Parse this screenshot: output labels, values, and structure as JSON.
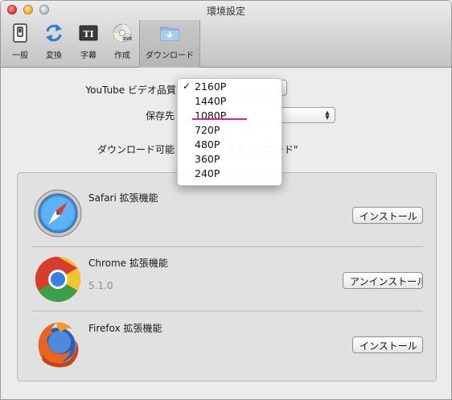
{
  "window": {
    "title": "環境設定"
  },
  "toolbar": {
    "items": [
      {
        "label": "一般",
        "icon": "switch-icon"
      },
      {
        "label": "変換",
        "icon": "convert-arrows-icon"
      },
      {
        "label": "字幕",
        "icon": "subtitle-ti-icon"
      },
      {
        "label": "作成",
        "icon": "disc-icon"
      },
      {
        "label": "ダウンロード",
        "icon": "download-folder-icon",
        "selected": true
      }
    ]
  },
  "settings": {
    "quality_label": "YouTube ビデオ品質",
    "save_label": "保存先",
    "save_value_partial": "ビ",
    "download_label": "ダウンロード可能",
    "download_value_partial": "能ダウンロード\""
  },
  "quality_menu": {
    "options": [
      "2160P",
      "1440P",
      "1080P",
      "720P",
      "480P",
      "360P",
      "240P"
    ],
    "checked_index": 0,
    "check_mark": "✓",
    "highlight_color": "#e0209e"
  },
  "extensions": [
    {
      "name": "Safari 拡張機能",
      "version": "",
      "button": "インストール",
      "icon": "safari-compass-icon"
    },
    {
      "name": "Chrome 拡張機能",
      "version": "5.1.0",
      "button": "アンインストール",
      "icon": "chrome-logo-icon"
    },
    {
      "name": "Firefox 拡張機能",
      "version": "",
      "button": "インストール",
      "icon": "firefox-logo-icon"
    }
  ]
}
